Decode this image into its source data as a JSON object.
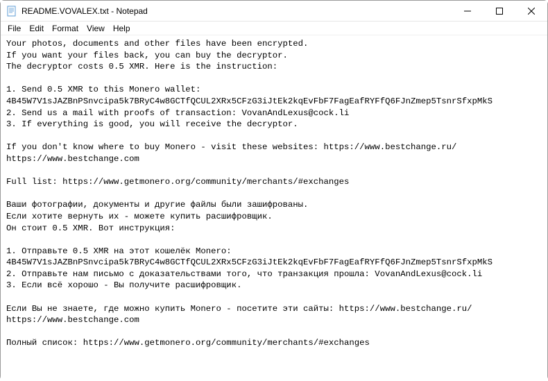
{
  "window": {
    "title": "README.VOVALEX.txt - Notepad"
  },
  "menubar": {
    "file": "File",
    "edit": "Edit",
    "format": "Format",
    "view": "View",
    "help": "Help"
  },
  "content": {
    "body": "Your photos, documents and other files have been encrypted.\nIf you want your files back, you can buy the decryptor.\nThe decryptor costs 0.5 XMR. Here is the instruction:\n\n1. Send 0.5 XMR to this Monero wallet: 4B45W7V1sJAZBnPSnvcipa5k7BRyC4w8GCTfQCUL2XRx5CFzG3iJtEk2kqEvFbF7FagEafRYFfQ6FJnZmep5TsnrSfxpMkS\n2. Send us a mail with proofs of transaction: VovanAndLexus@cock.li\n3. If everything is good, you will receive the decryptor.\n\nIf you don't know where to buy Monero - visit these websites: https://www.bestchange.ru/ https://www.bestchange.com\n\nFull list: https://www.getmonero.org/community/merchants/#exchanges\n\nВаши фотографии, документы и другие файлы были зашифрованы.\nЕсли хотите вернуть их - можете купить расшифровщик.\nОн стоит 0.5 XMR. Вот инструкция:\n\n1. Отправьте 0.5 XMR на этот кошелёк Monero: 4B45W7V1sJAZBnPSnvcipa5k7BRyC4w8GCTfQCUL2XRx5CFzG3iJtEk2kqEvFbF7FagEafRYFfQ6FJnZmep5TsnrSfxpMkS\n2. Отправьте нам письмо с доказательствами того, что транзакция прошла: VovanAndLexus@cock.li\n3. Если всё хорошо - Вы получите расшифровщик.\n\nЕсли Вы не знаете, где можно купить Monero - посетите эти сайты: https://www.bestchange.ru/ https://www.bestchange.com\n\nПолный список: https://www.getmonero.org/community/merchants/#exchanges"
  }
}
